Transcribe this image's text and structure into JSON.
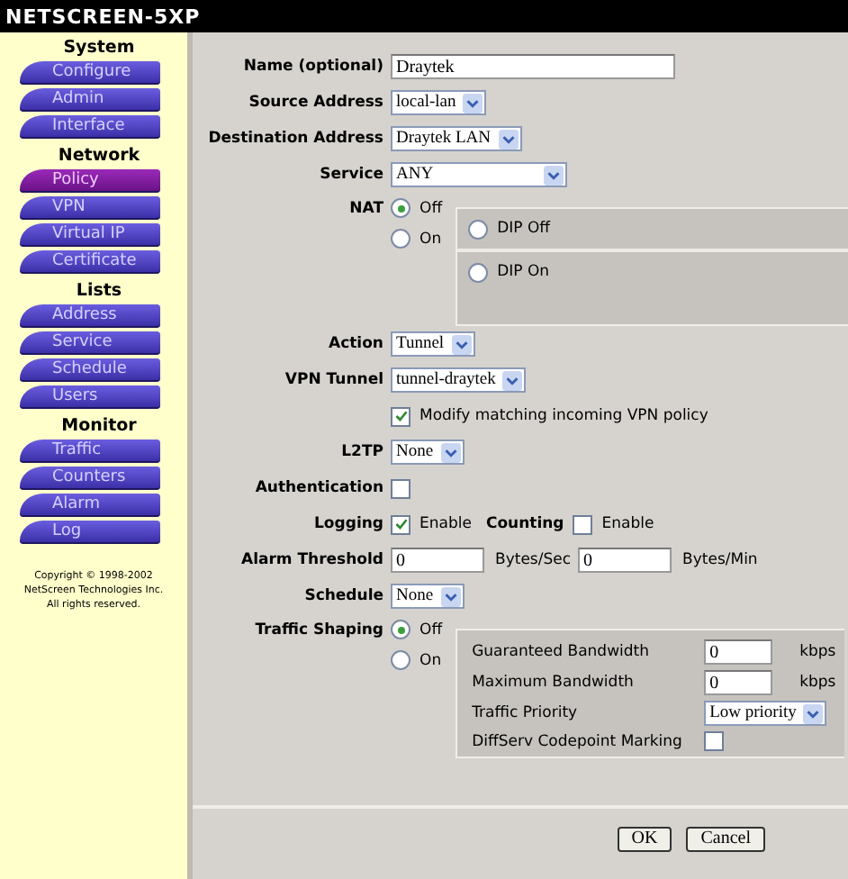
{
  "header": {
    "logo": "NETSCREEN-5XP"
  },
  "sidebar": {
    "sections": [
      {
        "title": "System",
        "items": [
          {
            "label": "Configure",
            "selected": false
          },
          {
            "label": "Admin",
            "selected": false
          },
          {
            "label": "Interface",
            "selected": false
          }
        ]
      },
      {
        "title": "Network",
        "items": [
          {
            "label": "Policy",
            "selected": true
          },
          {
            "label": "VPN",
            "selected": false
          },
          {
            "label": "Virtual IP",
            "selected": false
          },
          {
            "label": "Certificate",
            "selected": false
          }
        ]
      },
      {
        "title": "Lists",
        "items": [
          {
            "label": "Address",
            "selected": false
          },
          {
            "label": "Service",
            "selected": false
          },
          {
            "label": "Schedule",
            "selected": false
          },
          {
            "label": "Users",
            "selected": false
          }
        ]
      },
      {
        "title": "Monitor",
        "items": [
          {
            "label": "Traffic",
            "selected": false
          },
          {
            "label": "Counters",
            "selected": false
          },
          {
            "label": "Alarm",
            "selected": false
          },
          {
            "label": "Log",
            "selected": false
          }
        ]
      }
    ],
    "copyright": [
      "Copyright © 1998-2002",
      "NetScreen Technologies Inc.",
      "All rights reserved."
    ]
  },
  "form": {
    "rows": [
      {
        "kind": "text",
        "label": "Name (optional)",
        "value": "Draytek"
      },
      {
        "kind": "select",
        "label": "Source Address",
        "value": "local-lan"
      },
      {
        "kind": "select",
        "label": "Destination Address",
        "value": "Draytek LAN"
      },
      {
        "kind": "wide-select",
        "label": "Service",
        "value": "ANY"
      },
      {
        "kind": "radio-group",
        "label": "NAT",
        "options": [
          {
            "label": "Off",
            "selected": true
          },
          {
            "label": "On",
            "selected": false
          }
        ],
        "suboptions": [
          {
            "kind": "radio",
            "label": "DIP Off",
            "selected": false
          },
          {
            "kind": "radio",
            "label": "DIP On",
            "selected": false
          }
        ]
      },
      {
        "kind": "select",
        "label": "Action",
        "value": "Tunnel"
      },
      {
        "kind": "select",
        "label": "VPN Tunnel",
        "value": "tunnel-draytek"
      },
      {
        "kind": "checkbox",
        "text": "Modify matching incoming VPN policy",
        "checked": true
      },
      {
        "kind": "select",
        "label": "L2TP",
        "value": "None"
      },
      {
        "kind": "checkbox",
        "label": "Authentication",
        "checked": false
      },
      {
        "kind": "pair",
        "items": [
          {
            "label": "Logging",
            "text": "Enable",
            "checked": true
          },
          {
            "label": "Counting",
            "text": "Enable",
            "checked": false
          }
        ]
      },
      {
        "kind": "threshold",
        "label": "Alarm Threshold",
        "fields": [
          {
            "value": "0",
            "unit": "Bytes/Sec"
          },
          {
            "value": "0",
            "unit": "Bytes/Min"
          }
        ]
      },
      {
        "kind": "select",
        "label": "Schedule",
        "value": "None"
      },
      {
        "kind": "radio-group",
        "label": "Traffic Shaping",
        "options": [
          {
            "label": "Off",
            "selected": true
          },
          {
            "label": "On",
            "selected": false
          }
        ],
        "suboptions": [
          {
            "kind": "field",
            "label": "Guaranteed Bandwidth",
            "value": "0",
            "unit": "kbps"
          },
          {
            "kind": "field",
            "label": "Maximum Bandwidth",
            "value": "0",
            "unit": "kbps"
          },
          {
            "kind": "select",
            "label": "Traffic Priority",
            "value": "Low priority"
          },
          {
            "kind": "checkbox",
            "label": "DiffServ Codepoint Marking",
            "checked": false
          }
        ]
      }
    ]
  },
  "buttons": [
    "OK",
    "Cancel"
  ]
}
